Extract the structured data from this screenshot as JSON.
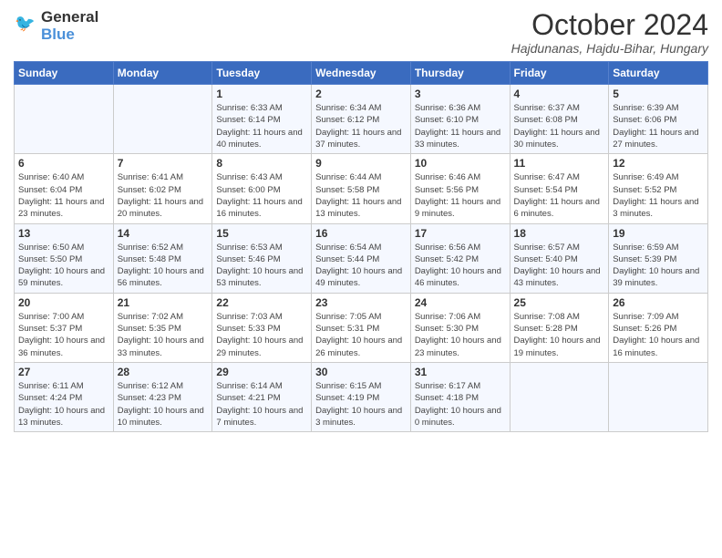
{
  "header": {
    "logo_text_general": "General",
    "logo_text_blue": "Blue",
    "month_title": "October 2024",
    "location": "Hajdunanas, Hajdu-Bihar, Hungary"
  },
  "days_of_week": [
    "Sunday",
    "Monday",
    "Tuesday",
    "Wednesday",
    "Thursday",
    "Friday",
    "Saturday"
  ],
  "weeks": [
    [
      {
        "day": "",
        "info": ""
      },
      {
        "day": "",
        "info": ""
      },
      {
        "day": "1",
        "info": "Sunrise: 6:33 AM\nSunset: 6:14 PM\nDaylight: 11 hours and 40 minutes."
      },
      {
        "day": "2",
        "info": "Sunrise: 6:34 AM\nSunset: 6:12 PM\nDaylight: 11 hours and 37 minutes."
      },
      {
        "day": "3",
        "info": "Sunrise: 6:36 AM\nSunset: 6:10 PM\nDaylight: 11 hours and 33 minutes."
      },
      {
        "day": "4",
        "info": "Sunrise: 6:37 AM\nSunset: 6:08 PM\nDaylight: 11 hours and 30 minutes."
      },
      {
        "day": "5",
        "info": "Sunrise: 6:39 AM\nSunset: 6:06 PM\nDaylight: 11 hours and 27 minutes."
      }
    ],
    [
      {
        "day": "6",
        "info": "Sunrise: 6:40 AM\nSunset: 6:04 PM\nDaylight: 11 hours and 23 minutes."
      },
      {
        "day": "7",
        "info": "Sunrise: 6:41 AM\nSunset: 6:02 PM\nDaylight: 11 hours and 20 minutes."
      },
      {
        "day": "8",
        "info": "Sunrise: 6:43 AM\nSunset: 6:00 PM\nDaylight: 11 hours and 16 minutes."
      },
      {
        "day": "9",
        "info": "Sunrise: 6:44 AM\nSunset: 5:58 PM\nDaylight: 11 hours and 13 minutes."
      },
      {
        "day": "10",
        "info": "Sunrise: 6:46 AM\nSunset: 5:56 PM\nDaylight: 11 hours and 9 minutes."
      },
      {
        "day": "11",
        "info": "Sunrise: 6:47 AM\nSunset: 5:54 PM\nDaylight: 11 hours and 6 minutes."
      },
      {
        "day": "12",
        "info": "Sunrise: 6:49 AM\nSunset: 5:52 PM\nDaylight: 11 hours and 3 minutes."
      }
    ],
    [
      {
        "day": "13",
        "info": "Sunrise: 6:50 AM\nSunset: 5:50 PM\nDaylight: 10 hours and 59 minutes."
      },
      {
        "day": "14",
        "info": "Sunrise: 6:52 AM\nSunset: 5:48 PM\nDaylight: 10 hours and 56 minutes."
      },
      {
        "day": "15",
        "info": "Sunrise: 6:53 AM\nSunset: 5:46 PM\nDaylight: 10 hours and 53 minutes."
      },
      {
        "day": "16",
        "info": "Sunrise: 6:54 AM\nSunset: 5:44 PM\nDaylight: 10 hours and 49 minutes."
      },
      {
        "day": "17",
        "info": "Sunrise: 6:56 AM\nSunset: 5:42 PM\nDaylight: 10 hours and 46 minutes."
      },
      {
        "day": "18",
        "info": "Sunrise: 6:57 AM\nSunset: 5:40 PM\nDaylight: 10 hours and 43 minutes."
      },
      {
        "day": "19",
        "info": "Sunrise: 6:59 AM\nSunset: 5:39 PM\nDaylight: 10 hours and 39 minutes."
      }
    ],
    [
      {
        "day": "20",
        "info": "Sunrise: 7:00 AM\nSunset: 5:37 PM\nDaylight: 10 hours and 36 minutes."
      },
      {
        "day": "21",
        "info": "Sunrise: 7:02 AM\nSunset: 5:35 PM\nDaylight: 10 hours and 33 minutes."
      },
      {
        "day": "22",
        "info": "Sunrise: 7:03 AM\nSunset: 5:33 PM\nDaylight: 10 hours and 29 minutes."
      },
      {
        "day": "23",
        "info": "Sunrise: 7:05 AM\nSunset: 5:31 PM\nDaylight: 10 hours and 26 minutes."
      },
      {
        "day": "24",
        "info": "Sunrise: 7:06 AM\nSunset: 5:30 PM\nDaylight: 10 hours and 23 minutes."
      },
      {
        "day": "25",
        "info": "Sunrise: 7:08 AM\nSunset: 5:28 PM\nDaylight: 10 hours and 19 minutes."
      },
      {
        "day": "26",
        "info": "Sunrise: 7:09 AM\nSunset: 5:26 PM\nDaylight: 10 hours and 16 minutes."
      }
    ],
    [
      {
        "day": "27",
        "info": "Sunrise: 6:11 AM\nSunset: 4:24 PM\nDaylight: 10 hours and 13 minutes."
      },
      {
        "day": "28",
        "info": "Sunrise: 6:12 AM\nSunset: 4:23 PM\nDaylight: 10 hours and 10 minutes."
      },
      {
        "day": "29",
        "info": "Sunrise: 6:14 AM\nSunset: 4:21 PM\nDaylight: 10 hours and 7 minutes."
      },
      {
        "day": "30",
        "info": "Sunrise: 6:15 AM\nSunset: 4:19 PM\nDaylight: 10 hours and 3 minutes."
      },
      {
        "day": "31",
        "info": "Sunrise: 6:17 AM\nSunset: 4:18 PM\nDaylight: 10 hours and 0 minutes."
      },
      {
        "day": "",
        "info": ""
      },
      {
        "day": "",
        "info": ""
      }
    ]
  ]
}
